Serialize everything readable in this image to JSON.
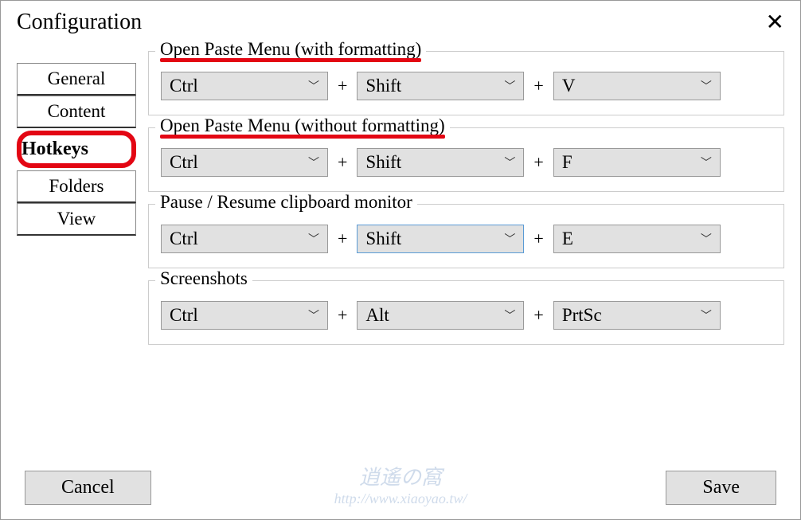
{
  "window": {
    "title": "Configuration"
  },
  "tabs": [
    {
      "label": "General"
    },
    {
      "label": "Content"
    },
    {
      "label": "Hotkeys"
    },
    {
      "label": "Folders"
    },
    {
      "label": "View"
    }
  ],
  "sections": {
    "open_with_fmt": {
      "title": "Open Paste Menu (with formatting)",
      "key1": "Ctrl",
      "key2": "Shift",
      "key3": "V"
    },
    "open_without_fmt": {
      "title": "Open Paste Menu (without formatting)",
      "key1": "Ctrl",
      "key2": "Shift",
      "key3": "F"
    },
    "pause_resume": {
      "title": "Pause / Resume clipboard monitor",
      "key1": "Ctrl",
      "key2": "Shift",
      "key3": "E"
    },
    "screenshots": {
      "title": "Screenshots",
      "key1": "Ctrl",
      "key2": "Alt",
      "key3": "PrtSc"
    }
  },
  "buttons": {
    "cancel": "Cancel",
    "save": "Save"
  },
  "plus": "+",
  "watermark": {
    "top": "逍遙の窩",
    "url": "http://www.xiaoyao.tw/"
  }
}
